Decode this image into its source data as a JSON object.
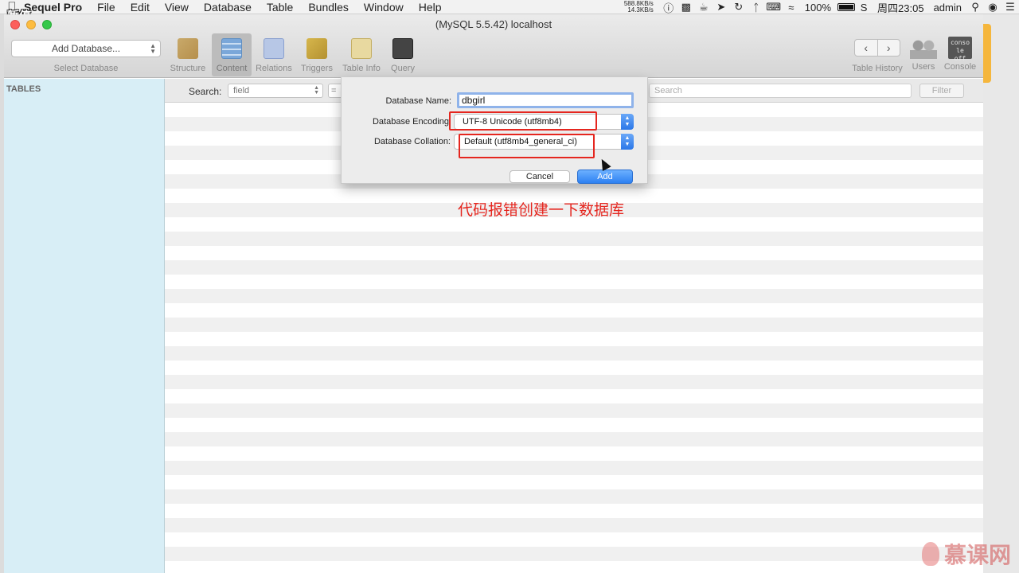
{
  "menubar": {
    "app_name": "Sequel Pro",
    "items": [
      "File",
      "Edit",
      "View",
      "Database",
      "Table",
      "Bundles",
      "Window",
      "Help"
    ],
    "net_up": "588.8KB/s",
    "net_down": "14.3KB/s",
    "battery": "100%",
    "clock": "周四23:05",
    "user": "admin",
    "pause_label": "暂停"
  },
  "window": {
    "title": "(MySQL 5.5.42) localhost"
  },
  "toolbar": {
    "db_select_label": "Add Database...",
    "db_select_caption": "Select Database",
    "tools": [
      "Structure",
      "Content",
      "Relations",
      "Triggers",
      "Table Info",
      "Query"
    ],
    "right_tools": [
      "Table History",
      "Users",
      "Console"
    ],
    "console_icon_text": "conso\nle off"
  },
  "sidebar": {
    "header": "TABLES"
  },
  "filter": {
    "search_label": "Search:",
    "field_value": "field",
    "operator": "=",
    "search_placeholder": "Search",
    "button_label": "Filter"
  },
  "dialog": {
    "name_label": "Database Name:",
    "name_value": "dbgirl",
    "encoding_label": "Database Encoding",
    "encoding_value": "UTF-8 Unicode (utf8mb4)",
    "collation_label": "Database Collation:",
    "collation_value": "Default (utf8mb4_general_ci)",
    "cancel_label": "Cancel",
    "add_label": "Add"
  },
  "annotation": {
    "text": "代码报错创建一下数据库",
    "color": "#e5261f"
  },
  "watermark": {
    "text": "慕课网"
  },
  "colors": {
    "sidebar_bg": "#d8eef6",
    "accent_blue": "#2d80f2"
  }
}
